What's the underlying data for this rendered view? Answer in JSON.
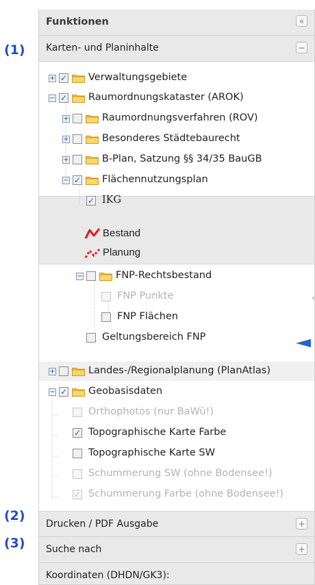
{
  "callouts": [
    "(1)",
    "(2)",
    "(3)"
  ],
  "panel": {
    "title": "Funktionen",
    "collapse_symbol": "«"
  },
  "sections": {
    "maps": {
      "label": "Karten- und Planinhalte",
      "toggle": "−"
    },
    "print": {
      "label": "Drucken / PDF Ausgabe",
      "toggle": "+"
    },
    "search": {
      "label": "Suche nach",
      "toggle": "+"
    },
    "coords": {
      "label": "Koordinaten (DHDN/GK3):"
    }
  },
  "tree": [
    {
      "id": "verwaltungsgebiete",
      "label": "Verwaltungsgebiete",
      "expander": "+",
      "checked": true,
      "folder": true
    },
    {
      "id": "arok",
      "label": "Raumordnungskataster (AROK)",
      "expander": "−",
      "checked": true,
      "folder": true
    },
    {
      "id": "rov",
      "label": "Raumordnungsverfahren (ROV)",
      "expander": "+",
      "checked": false,
      "folder": true
    },
    {
      "id": "staedtebaurecht",
      "label": "Besonderes Städtebaurecht",
      "expander": "+",
      "checked": false,
      "folder": true
    },
    {
      "id": "bplan",
      "label": "B-Plan, Satzung §§ 34/35 BauGB",
      "expander": "+",
      "checked": false,
      "folder": true
    },
    {
      "id": "fnp",
      "label": "Flächennutzungsplan",
      "expander": "−",
      "checked": true,
      "folder": true
    },
    {
      "id": "ikg",
      "label": "IKG",
      "checked": true
    },
    {
      "id": "fnp-rechtsbestand",
      "label": "FNP-Rechtsbestand",
      "expander": "−",
      "checked": false,
      "folder": true
    },
    {
      "id": "fnp-punkte",
      "label": "FNP Punkte",
      "checked": false,
      "disabled": true
    },
    {
      "id": "fnp-flaechen",
      "label": "FNP Flächen",
      "checked": false
    },
    {
      "id": "geltungsbereich",
      "label": "Geltungsbereich FNP",
      "checked": false
    },
    {
      "id": "landesplanung",
      "label": "Landes-/Regionalplanung (PlanAtlas)",
      "expander": "+",
      "checked": false,
      "folder": true
    },
    {
      "id": "geobasisdaten",
      "label": "Geobasisdaten",
      "expander": "−",
      "checked": true,
      "folder": true
    },
    {
      "id": "orthophotos",
      "label": "Orthophotos (nur BaWü!)",
      "checked": false,
      "disabled": true
    },
    {
      "id": "topo-farbe",
      "label": "Topographische Karte Farbe",
      "checked": true
    },
    {
      "id": "topo-sw",
      "label": "Topographische Karte SW",
      "checked": false
    },
    {
      "id": "schummerung-sw",
      "label": "Schummerung SW (ohne Bodensee!)",
      "checked": false,
      "disabled": true
    },
    {
      "id": "schummerung-farbe",
      "label": "Schummerung Farbe (ohne Bodensee!)",
      "checked": true,
      "disabled": true
    }
  ],
  "legend": [
    {
      "label": "Bestand",
      "color": "#e8151b"
    },
    {
      "label": "Planung",
      "color": "#e8151b"
    }
  ],
  "check_mark": "✓",
  "colors": {
    "callout": "#1f4fc1",
    "folder": "#f6c94a",
    "arrow": "#2864c8"
  }
}
